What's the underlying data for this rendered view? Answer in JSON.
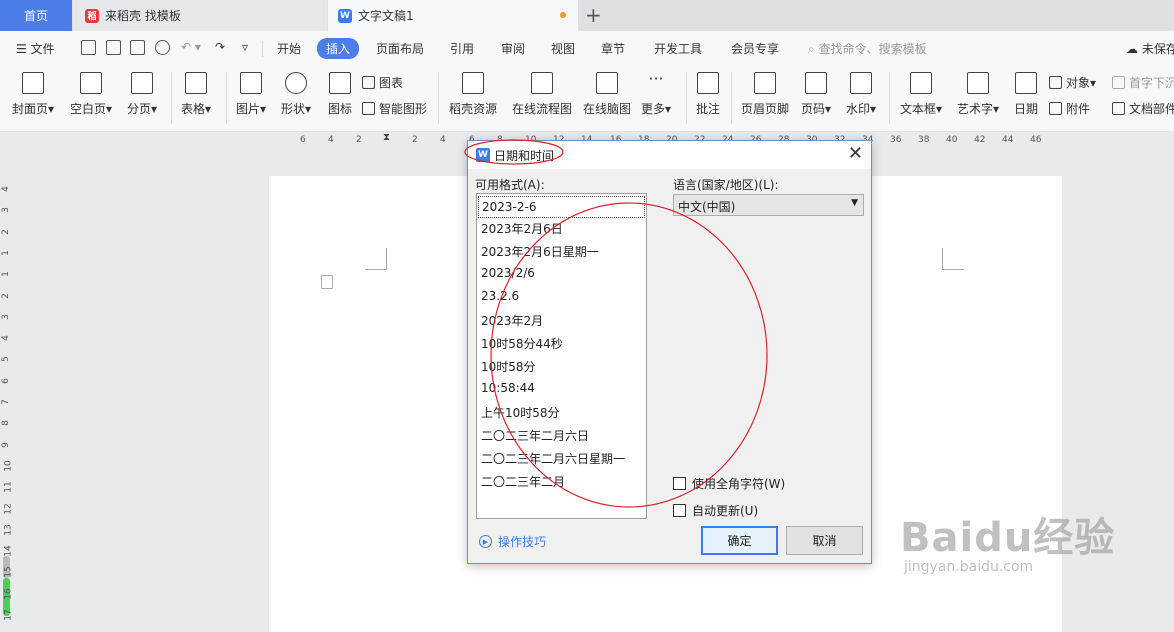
{
  "tabs": {
    "home": "首页",
    "daoke": "来稻壳 找模板",
    "doc": "文字文稿1"
  },
  "menu": {
    "file": "文件",
    "items": [
      "开始",
      "插入",
      "页面布局",
      "引用",
      "审阅",
      "视图",
      "章节",
      "开发工具",
      "会员专享"
    ],
    "active": "插入",
    "search": "查找命令、搜索模板",
    "unsaved": "未保存"
  },
  "ribbon": {
    "cover": "封面页",
    "blank": "空白页",
    "pagebreak": "分页",
    "table": "表格",
    "picture": "图片",
    "shape": "形状",
    "icon": "图标",
    "chart": "图表",
    "smartart": "智能图形",
    "daoke_res": "稻壳资源",
    "flowchart": "在线流程图",
    "mindmap": "在线脑图",
    "more": "更多",
    "comment": "批注",
    "headerfooter": "页眉页脚",
    "pagenum": "页码",
    "watermark": "水印",
    "textbox": "文本框",
    "wordart": "艺术字",
    "date": "日期",
    "object": "对象",
    "attach": "附件",
    "dropcap": "首字下沉",
    "docpart": "文档部件"
  },
  "ruler": {
    "top": [
      "6",
      "4",
      "2",
      "2",
      "4",
      "6",
      "8",
      "10",
      "12",
      "14",
      "16",
      "18",
      "20",
      "22",
      "24",
      "26",
      "28",
      "30",
      "32",
      "34",
      "36",
      "38",
      "40",
      "42",
      "44",
      "46"
    ],
    "left": [
      "4",
      "3",
      "2",
      "1",
      "1",
      "2",
      "3",
      "4",
      "5",
      "6",
      "7",
      "8",
      "9",
      "10",
      "11",
      "12",
      "13",
      "14",
      "15",
      "16",
      "17"
    ]
  },
  "dialog": {
    "title": "日期和时间",
    "formats_label": "可用格式(A):",
    "language_label": "语言(国家/地区)(L):",
    "language_value": "中文(中国)",
    "formats": [
      "2023-2-6",
      "2023年2月6日",
      "2023年2月6日星期一",
      "2023/2/6",
      "23.2.6",
      "2023年2月",
      "10时58分44秒",
      "10时58分",
      "10:58:44",
      "上午10时58分",
      "二〇二三年二月六日",
      "二〇二三年二月六日星期一",
      "二〇二三年二月"
    ],
    "fullwidth": "使用全角字符(W)",
    "autoupdate": "自动更新(U)",
    "tips": "操作技巧",
    "ok": "确定",
    "cancel": "取消"
  },
  "watermark": {
    "brand": "Baidu经验",
    "url": "jingyan.baidu.com"
  },
  "colors": {
    "accent": "#4d7de9",
    "annotation": "#d9232e",
    "scroll_green": "#4ccf58"
  }
}
